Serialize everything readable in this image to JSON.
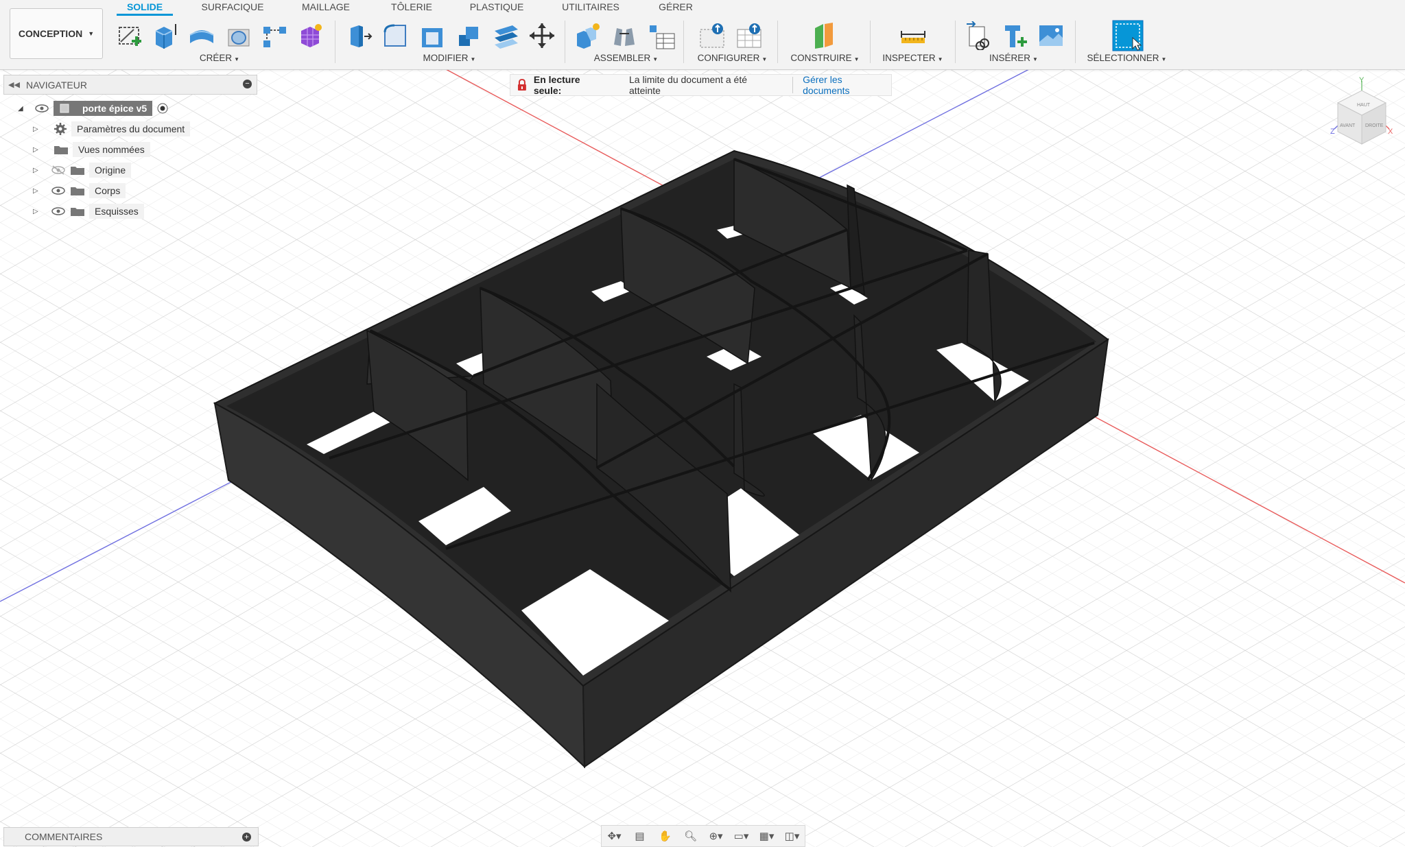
{
  "workspace": {
    "label": "CONCEPTION"
  },
  "tabs": [
    "SOLIDE",
    "SURFACIQUE",
    "MAILLAGE",
    "TÔLERIE",
    "PLASTIQUE",
    "UTILITAIRES",
    "GÉRER"
  ],
  "active_tab": "SOLIDE",
  "groups": {
    "create": "CRÉER",
    "modify": "MODIFIER",
    "assemble": "ASSEMBLER",
    "configure": "CONFIGURER",
    "construct": "CONSTRUIRE",
    "inspect": "INSPECTER",
    "insert": "INSÉRER",
    "select": "SÉLECTIONNER"
  },
  "navigator": {
    "title": "NAVIGATEUR",
    "root": "porte épice v5",
    "items": [
      "Paramètres du document",
      "Vues nommées",
      "Origine",
      "Corps",
      "Esquisses"
    ]
  },
  "banner": {
    "readonly_label": "En lecture seule:",
    "message": "La limite du document a été atteinte",
    "link": "Gérer les documents"
  },
  "viewcube": {
    "top": "HAUT",
    "front": "AVANT",
    "right": "DROITE",
    "axis_x": "X",
    "axis_y": "Y",
    "axis_z": "Z"
  },
  "comments": {
    "title": "COMMENTAIRES"
  },
  "colors": {
    "accent": "#0696d7",
    "model": "#2b2b2b",
    "grid": "#dcdcdc",
    "axis_x": "#e85a5a",
    "axis_z": "#6f6fe0"
  },
  "icons": [
    "sketch-icon",
    "extrude-icon",
    "revolve-icon",
    "hole-icon",
    "pattern-icon",
    "form-icon",
    "press-pull-icon",
    "fillet-icon",
    "shell-icon",
    "combine-icon",
    "offset-face-icon",
    "move-icon",
    "new-component-icon",
    "joint-icon",
    "bom-icon",
    "parameters-icon",
    "configure-table-icon",
    "plane-icon",
    "measure-icon",
    "insert-link-icon",
    "insert-mcmaster-icon",
    "canvas-icon",
    "select-icon"
  ]
}
